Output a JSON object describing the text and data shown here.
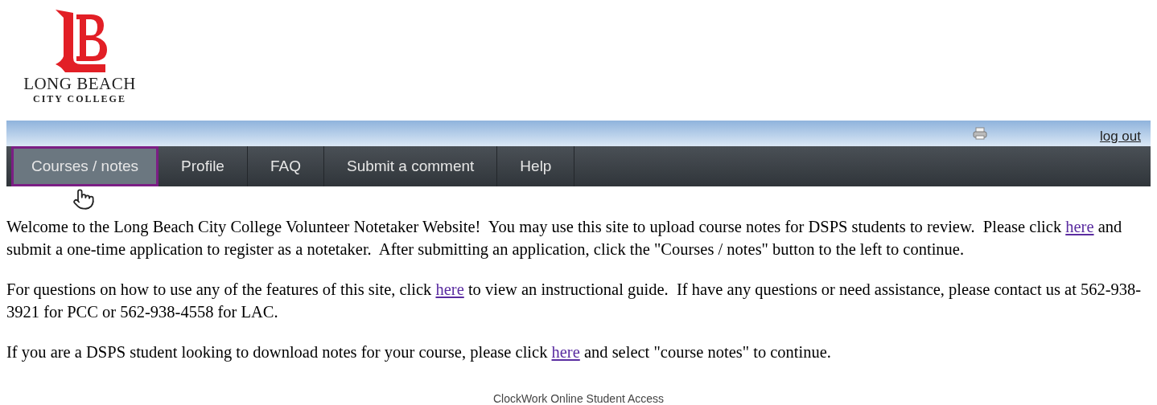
{
  "logo": {
    "name": "LONG BEACH",
    "subtitle": "CITY COLLEGE"
  },
  "top_bar": {
    "logout": "log out"
  },
  "nav": [
    {
      "label": "Courses / notes",
      "selected": true
    },
    {
      "label": "Profile",
      "selected": false
    },
    {
      "label": "FAQ",
      "selected": false
    },
    {
      "label": "Submit a comment",
      "selected": false
    },
    {
      "label": "Help",
      "selected": false
    }
  ],
  "paragraphs": [
    [
      {
        "kind": "text",
        "text": "Welcome to the Long Beach City College Volunteer Notetaker Website!  You may use this site to upload course notes for DSPS students to review.  Please click "
      },
      {
        "kind": "link",
        "text": "here"
      },
      {
        "kind": "text",
        "text": " and submit a one-time application to register as a notetaker.  After submitting an application, click the \"Courses / notes\" button to the left to continue."
      }
    ],
    [
      {
        "kind": "text",
        "text": "For questions on how to use any of the features of this site, click "
      },
      {
        "kind": "link",
        "text": "here"
      },
      {
        "kind": "text",
        "text": " to view an instructional guide.  If have any questions or need assistance, please contact us at 562-938-3921 for PCC or 562-938-4558 for LAC."
      }
    ],
    [
      {
        "kind": "text",
        "text": "If you are a DSPS student looking to download notes for your course, please click "
      },
      {
        "kind": "link",
        "text": "here"
      },
      {
        "kind": "text",
        "text": " and select \"course notes\" to continue."
      }
    ]
  ],
  "footer": "ClockWork Online Student Access"
}
